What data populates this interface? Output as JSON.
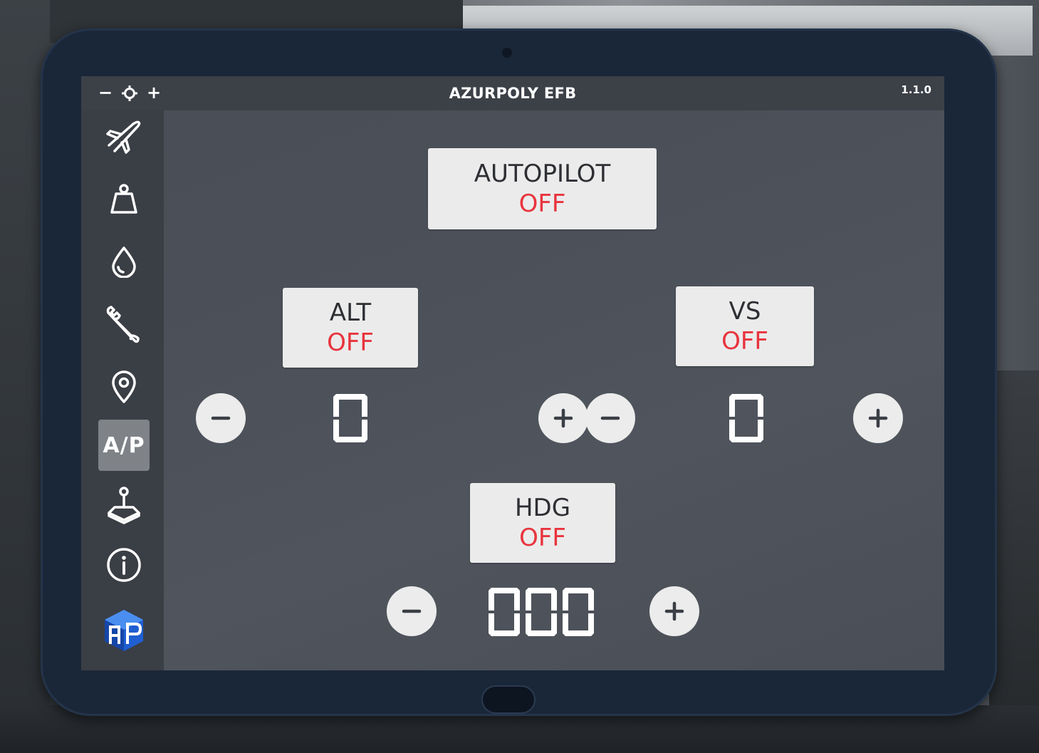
{
  "app": {
    "title": "AZURPOLY EFB",
    "version": "1.1.0",
    "brightness_down": "−",
    "brightness_up": "+"
  },
  "sidebar": {
    "items": [
      {
        "id": "flight",
        "icon": "airplane-icon",
        "active": false
      },
      {
        "id": "payload",
        "icon": "weight-icon",
        "active": false
      },
      {
        "id": "fuel",
        "icon": "droplet-icon",
        "active": false
      },
      {
        "id": "tools",
        "icon": "wrench-icon",
        "active": false
      },
      {
        "id": "map",
        "icon": "location-pin-icon",
        "active": false
      },
      {
        "id": "autopilot",
        "label": "A/P",
        "active": true
      },
      {
        "id": "controls",
        "icon": "joystick-icon",
        "active": false
      },
      {
        "id": "info",
        "icon": "info-icon",
        "active": false
      },
      {
        "id": "logo",
        "icon": "azurpoly-logo",
        "active": false
      }
    ]
  },
  "autopilot": {
    "master": {
      "label": "AUTOPILOT",
      "state": "OFF"
    },
    "alt": {
      "label": "ALT",
      "state": "OFF",
      "value": "0"
    },
    "vs": {
      "label": "VS",
      "state": "OFF",
      "value": "0"
    },
    "hdg": {
      "label": "HDG",
      "state": "OFF",
      "value": "000"
    }
  },
  "colors": {
    "off_state": "#e8343d",
    "tablet_bezel": "#1a2739",
    "screen": "#3a3e45",
    "button_bg": "#ebebeb"
  }
}
